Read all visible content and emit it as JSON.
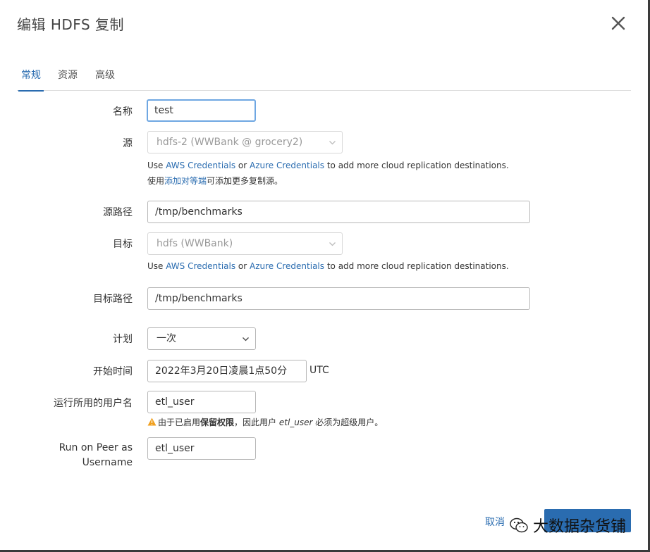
{
  "dialog": {
    "title": "编辑 HDFS 复制"
  },
  "tabs": [
    {
      "label": "常规",
      "active": true
    },
    {
      "label": "资源",
      "active": false
    },
    {
      "label": "高级",
      "active": false
    }
  ],
  "form": {
    "name": {
      "label": "名称",
      "value": "test"
    },
    "source": {
      "label": "源",
      "value": "hdfs-2 (WWBank @ grocery2)",
      "help_line1": {
        "pre": "Use ",
        "link1": "AWS Credentials",
        "mid": " or ",
        "link2": "Azure Credentials",
        "post": " to add more cloud replication destinations."
      },
      "help_line2": {
        "pre": "使用",
        "link": "添加对等端",
        "post": "可添加更多复制源。"
      }
    },
    "source_path": {
      "label": "源路径",
      "value": "/tmp/benchmarks"
    },
    "target": {
      "label": "目标",
      "value": "hdfs (WWBank)",
      "help_line1": {
        "pre": "Use ",
        "link1": "AWS Credentials",
        "mid": " or ",
        "link2": "Azure Credentials",
        "post": " to add more cloud replication destinations."
      }
    },
    "target_path": {
      "label": "目标路径",
      "value": "/tmp/benchmarks"
    },
    "schedule": {
      "label": "计划",
      "value": "一次"
    },
    "start_time": {
      "label": "开始时间",
      "value": "2022年3月20日凌晨1点50分",
      "timezone": "UTC"
    },
    "run_as_user": {
      "label": "运行所用的用户名",
      "value": "etl_user",
      "warning": {
        "pre": "由于已启用",
        "bold": "保留权限",
        "mid": "，因此用户 ",
        "italic": "etl_user",
        "post": " 必须为超级用户。"
      }
    },
    "run_on_peer": {
      "label_line1": "Run on Peer as",
      "label_line2": "Username",
      "value": "etl_user"
    }
  },
  "footer": {
    "cancel_label": "取消",
    "watermark_text": "大数据杂货铺"
  },
  "colors": {
    "accent": "#2a6cb0",
    "warning": "#f0a020"
  },
  "icons": {
    "close": "close-icon",
    "chevron": "chevron-down-icon",
    "warning": "warning-icon",
    "watermark": "wechat-icon"
  }
}
